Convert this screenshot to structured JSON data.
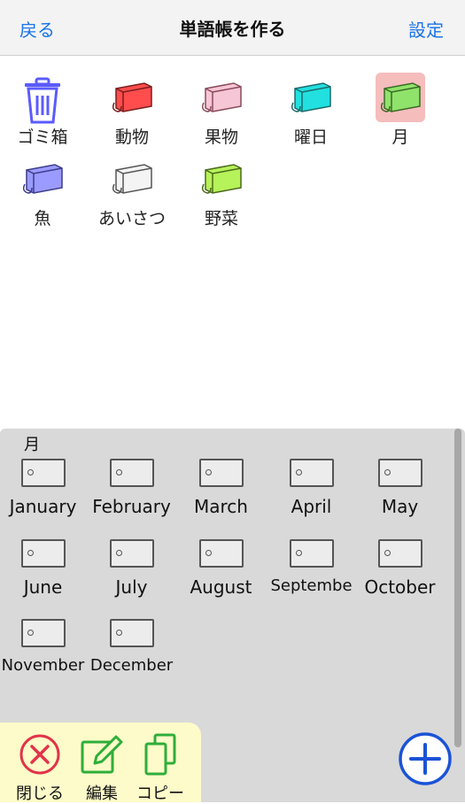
{
  "navbar": {
    "back_label": "戻る",
    "title": "単語帳を作る",
    "settings_label": "設定"
  },
  "books": [
    {
      "label": "ゴミ箱",
      "icon": "trash-icon",
      "color": "#5b5bff"
    },
    {
      "label": "動物",
      "icon": "book-icon",
      "color": "#ff4d4d"
    },
    {
      "label": "果物",
      "icon": "book-icon",
      "color": "#f7c6d6"
    },
    {
      "label": "曜日",
      "icon": "book-icon",
      "color": "#22e0e0"
    },
    {
      "label": "月",
      "icon": "book-icon",
      "color": "#8fe36a",
      "selected": true
    },
    {
      "label": "魚",
      "icon": "book-icon",
      "color": "#9b9bff"
    },
    {
      "label": "あいさつ",
      "icon": "book-icon",
      "color": "#f4f4f4"
    },
    {
      "label": "野菜",
      "icon": "book-icon",
      "color": "#b6f25a"
    }
  ],
  "panel": {
    "title": "月",
    "cards": [
      "January",
      "February",
      "March",
      "April",
      "May",
      "June",
      "July",
      "August",
      "Septembe",
      "October",
      "November",
      "December"
    ]
  },
  "toolbar": {
    "close_label": "閉じる",
    "edit_label": "編集",
    "copy_label": "コピー"
  },
  "colors": {
    "accent": "#1a73e8",
    "close_red": "#e0344a",
    "tool_green": "#2fae3a",
    "selected_bg": "#f6bdbd",
    "panel_bg": "#d9d9d9",
    "toolbar_bg": "#fdfbc9"
  },
  "fab": {
    "icon": "plus-circle-icon"
  }
}
